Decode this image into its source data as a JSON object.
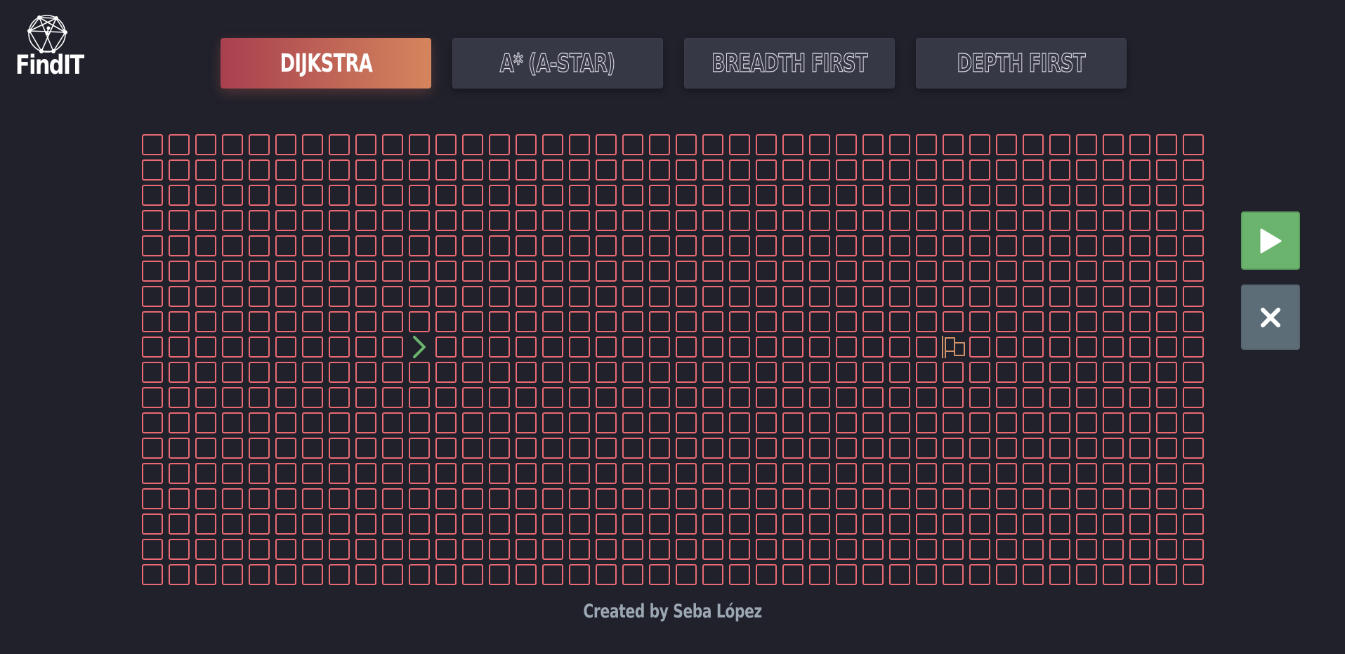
{
  "app": {
    "name": "FindIT",
    "footer": "Created by Seba López"
  },
  "algorithms": [
    {
      "label": "DIJKSTRA",
      "active": true
    },
    {
      "label": "A* (A-STAR)",
      "active": false
    },
    {
      "label": "BREADTH FIRST",
      "active": false
    },
    {
      "label": "DEPTH FIRST",
      "active": false
    }
  ],
  "grid": {
    "rows": 18,
    "cols": 40,
    "start": {
      "row": 8,
      "col": 10,
      "icon": "chevron-right-icon"
    },
    "target": {
      "row": 8,
      "col": 30,
      "icon": "flag-icon"
    }
  },
  "controls": {
    "play_icon": "play-icon",
    "clear_icon": "close-icon"
  },
  "colors": {
    "background": "#20212b",
    "cell_border": "#eb6a73",
    "button_bg": "#363845",
    "active_gradient_start": "#a8404f",
    "active_gradient_end": "#d5855d",
    "play": "#6bb46d",
    "clear": "#5d6d77",
    "start_icon": "#6bb46d",
    "target_icon": "#d0926a",
    "footer_text": "#9ba8b4"
  }
}
